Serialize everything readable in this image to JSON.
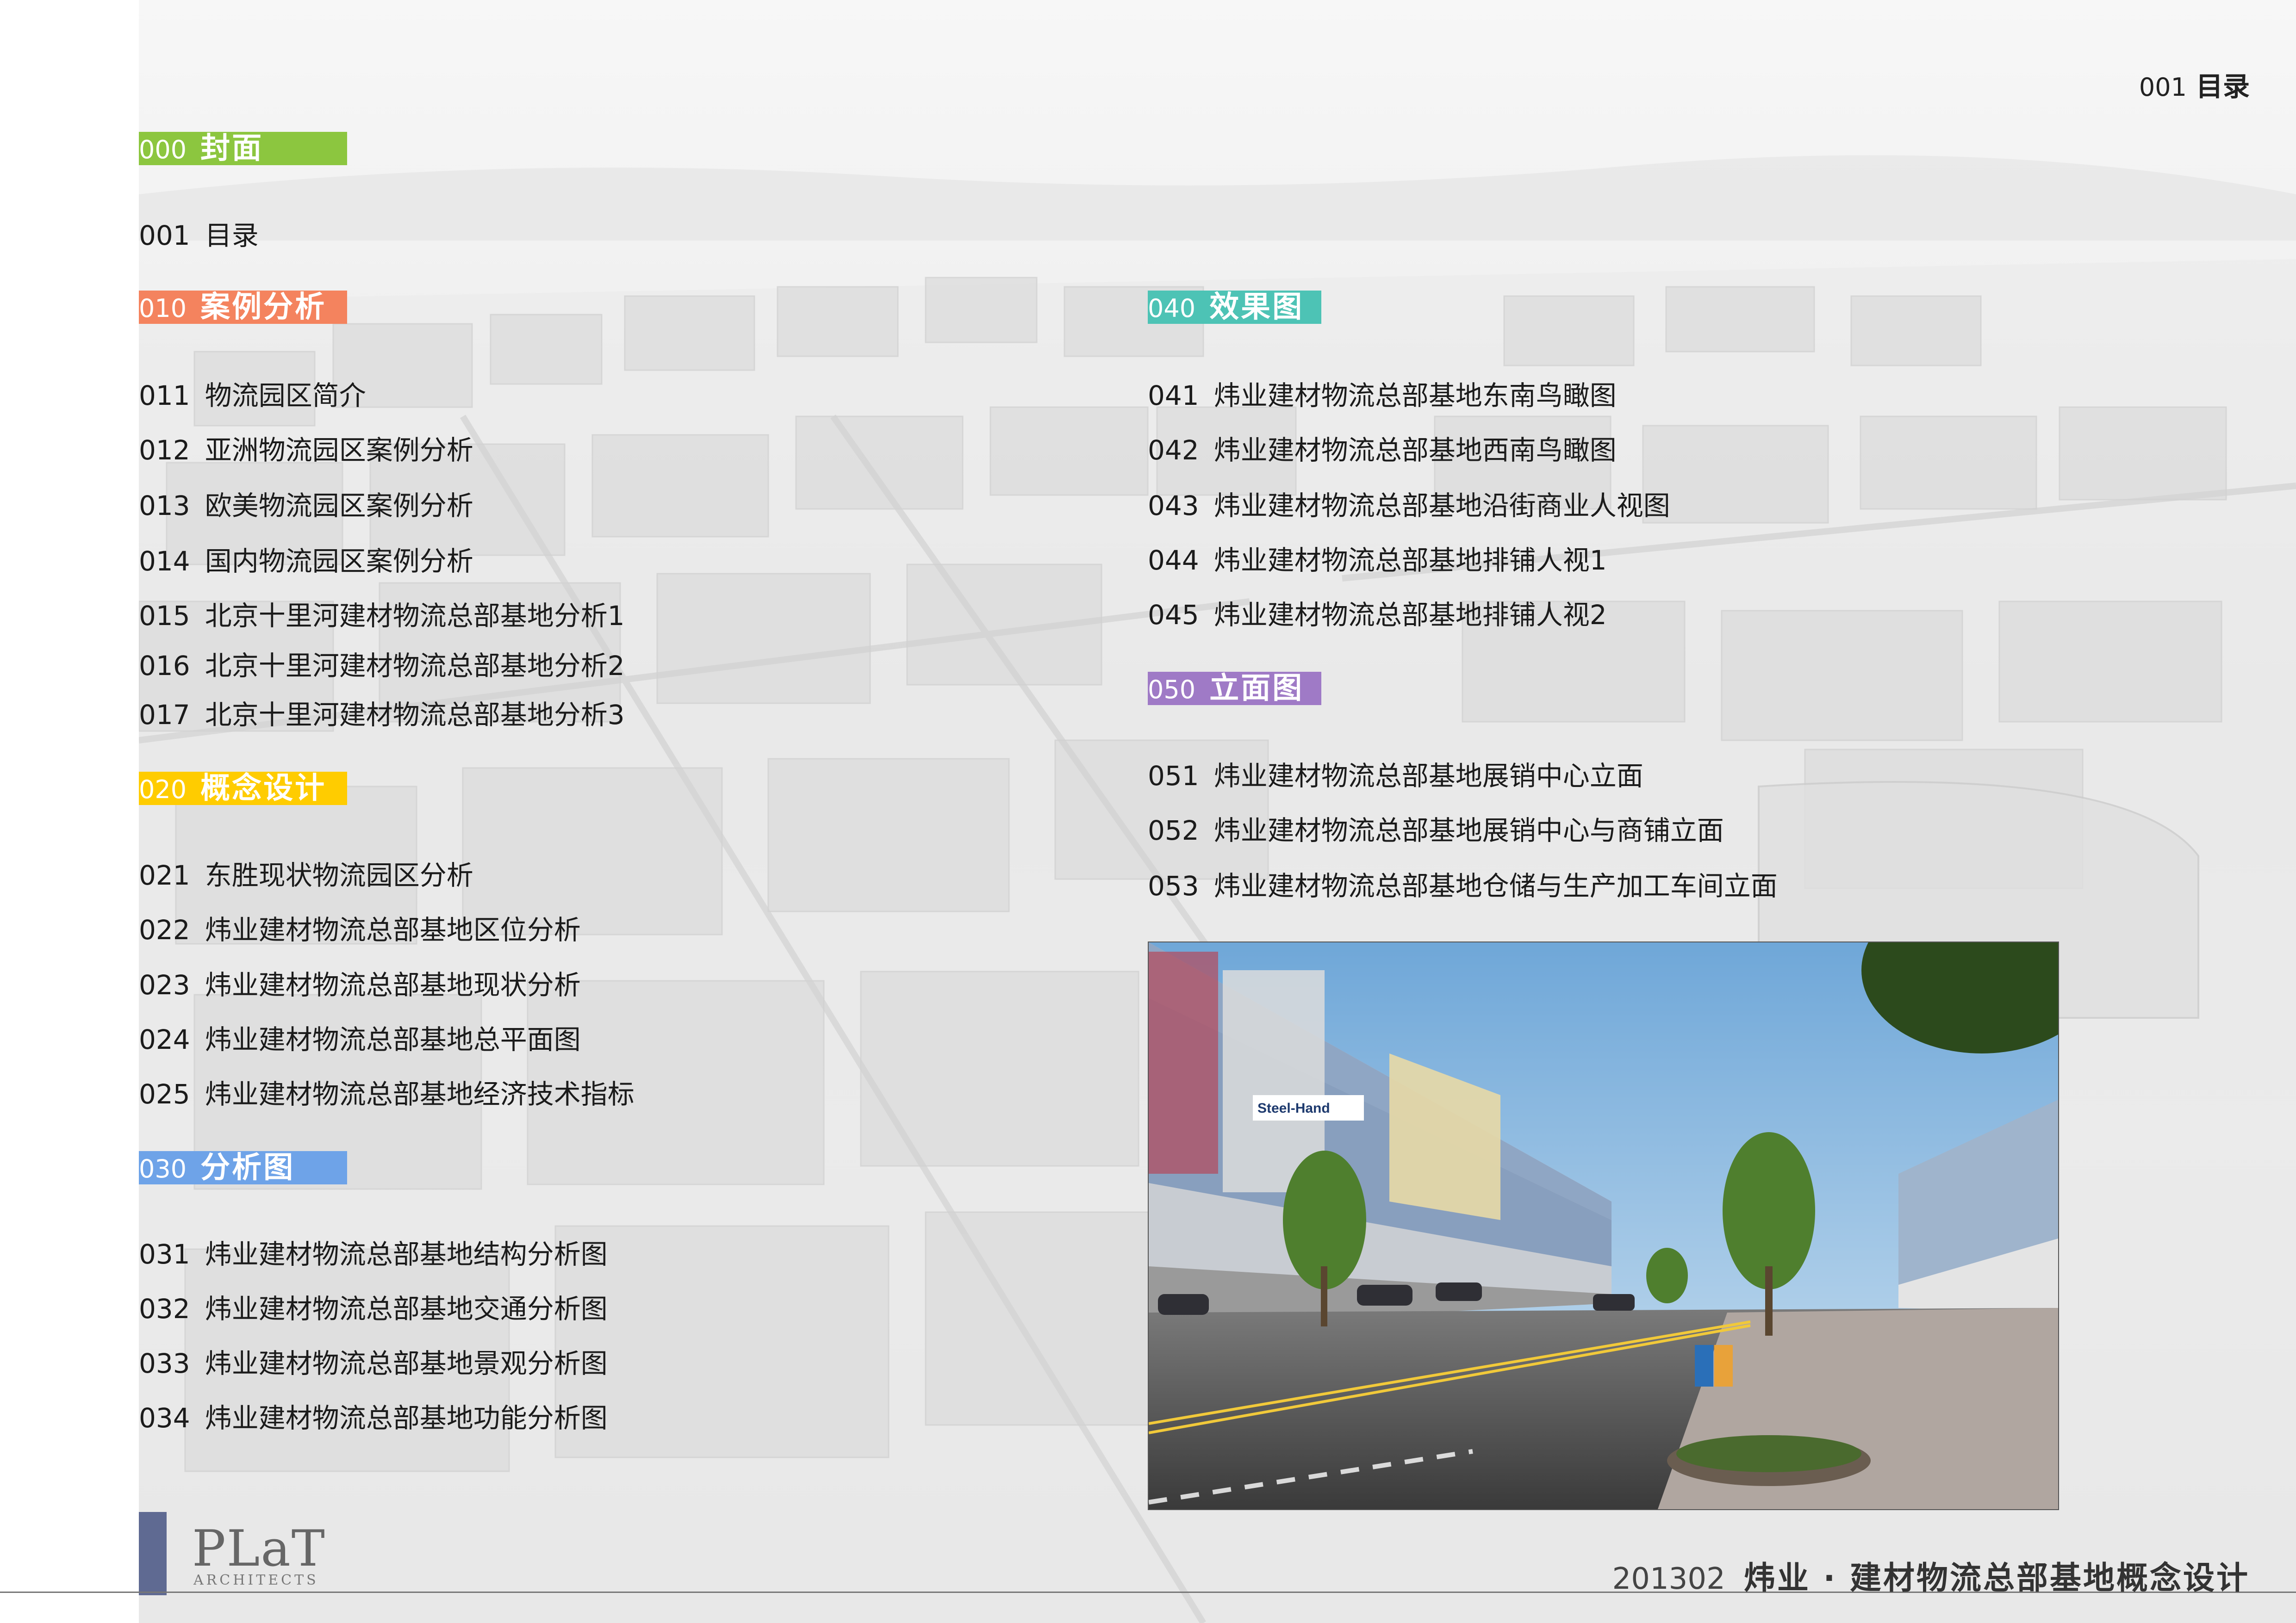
{
  "header": {
    "page_number": "001",
    "page_title": "目录"
  },
  "sections": {
    "s000": {
      "num": "000",
      "title": "封面",
      "color": "#8cc63f"
    },
    "s010": {
      "num": "010",
      "title": "案例分析",
      "color": "#f4835e"
    },
    "s020": {
      "num": "020",
      "title": "概念设计",
      "color": "#ffcc00"
    },
    "s030": {
      "num": "030",
      "title": "分析图",
      "color": "#6ea3e8"
    },
    "s040": {
      "num": "040",
      "title": "效果图",
      "color": "#4dc3b5"
    },
    "s050": {
      "num": "050",
      "title": "立面图",
      "color": "#9f7ac6"
    }
  },
  "items": {
    "i001": {
      "num": "001",
      "text": "目录"
    },
    "i011": {
      "num": "011",
      "text": "物流园区简介"
    },
    "i012": {
      "num": "012",
      "text": "亚洲物流园区案例分析"
    },
    "i013": {
      "num": "013",
      "text": "欧美物流园区案例分析"
    },
    "i014": {
      "num": "014",
      "text": "国内物流园区案例分析"
    },
    "i015": {
      "num": "015",
      "text": "北京十里河建材物流总部基地分析1"
    },
    "i016": {
      "num": "016",
      "text": "北京十里河建材物流总部基地分析2"
    },
    "i017": {
      "num": "017",
      "text": "北京十里河建材物流总部基地分析3"
    },
    "i021": {
      "num": "021",
      "text": "东胜现状物流园区分析"
    },
    "i022": {
      "num": "022",
      "text": "炜业建材物流总部基地区位分析"
    },
    "i023": {
      "num": "023",
      "text": "炜业建材物流总部基地现状分析"
    },
    "i024": {
      "num": "024",
      "text": "炜业建材物流总部基地总平面图"
    },
    "i025": {
      "num": "025",
      "text": "炜业建材物流总部基地经济技术指标"
    },
    "i031": {
      "num": "031",
      "text": "炜业建材物流总部基地结构分析图"
    },
    "i032": {
      "num": "032",
      "text": "炜业建材物流总部基地交通分析图"
    },
    "i033": {
      "num": "033",
      "text": "炜业建材物流总部基地景观分析图"
    },
    "i034": {
      "num": "034",
      "text": "炜业建材物流总部基地功能分析图"
    },
    "i041": {
      "num": "041",
      "text": "炜业建材物流总部基地东南鸟瞰图"
    },
    "i042": {
      "num": "042",
      "text": "炜业建材物流总部基地西南鸟瞰图"
    },
    "i043": {
      "num": "043",
      "text": "炜业建材物流总部基地沿街商业人视图"
    },
    "i044": {
      "num": "044",
      "text": "炜业建材物流总部基地排铺人视1"
    },
    "i045": {
      "num": "045",
      "text": "炜业建材物流总部基地排铺人视2"
    },
    "i051": {
      "num": "051",
      "text": "炜业建材物流总部基地展销中心立面"
    },
    "i052": {
      "num": "052",
      "text": "炜业建材物流总部基地展销中心与商铺立面"
    },
    "i053": {
      "num": "053",
      "text": "炜业建材物流总部基地仓储与生产加工车间立面"
    }
  },
  "photo": {
    "facade_sign": "Steel-Hand"
  },
  "footer": {
    "logo_main": "PLaT",
    "logo_sub": "ARCHITECTS",
    "year_code": "201302",
    "project_title": "炜业 · 建材物流总部基地概念设计",
    "bar_color": "#5f6a92"
  }
}
